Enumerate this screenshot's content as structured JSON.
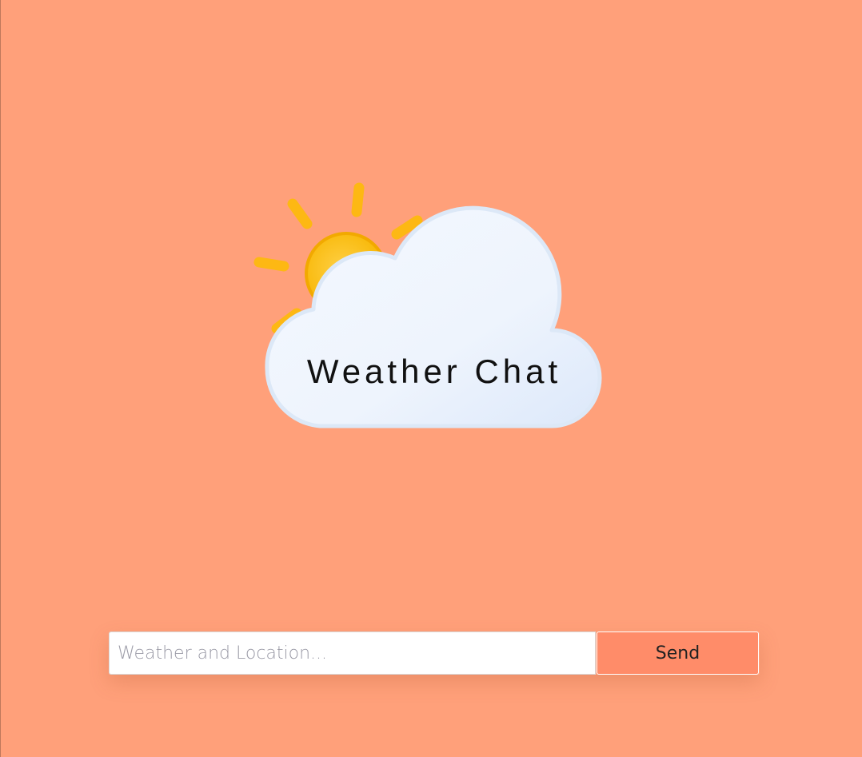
{
  "app": {
    "logo_title": "Weather Chat",
    "logo_icon": "sun-behind-cloud-icon"
  },
  "chat": {
    "input_placeholder": "Weather and Location...",
    "input_value": "",
    "send_label": "Send"
  },
  "colors": {
    "background": "#FFA07A",
    "send_button": "#FF8C69",
    "sun": "#FDB813",
    "cloud": "#EEF4FD"
  }
}
